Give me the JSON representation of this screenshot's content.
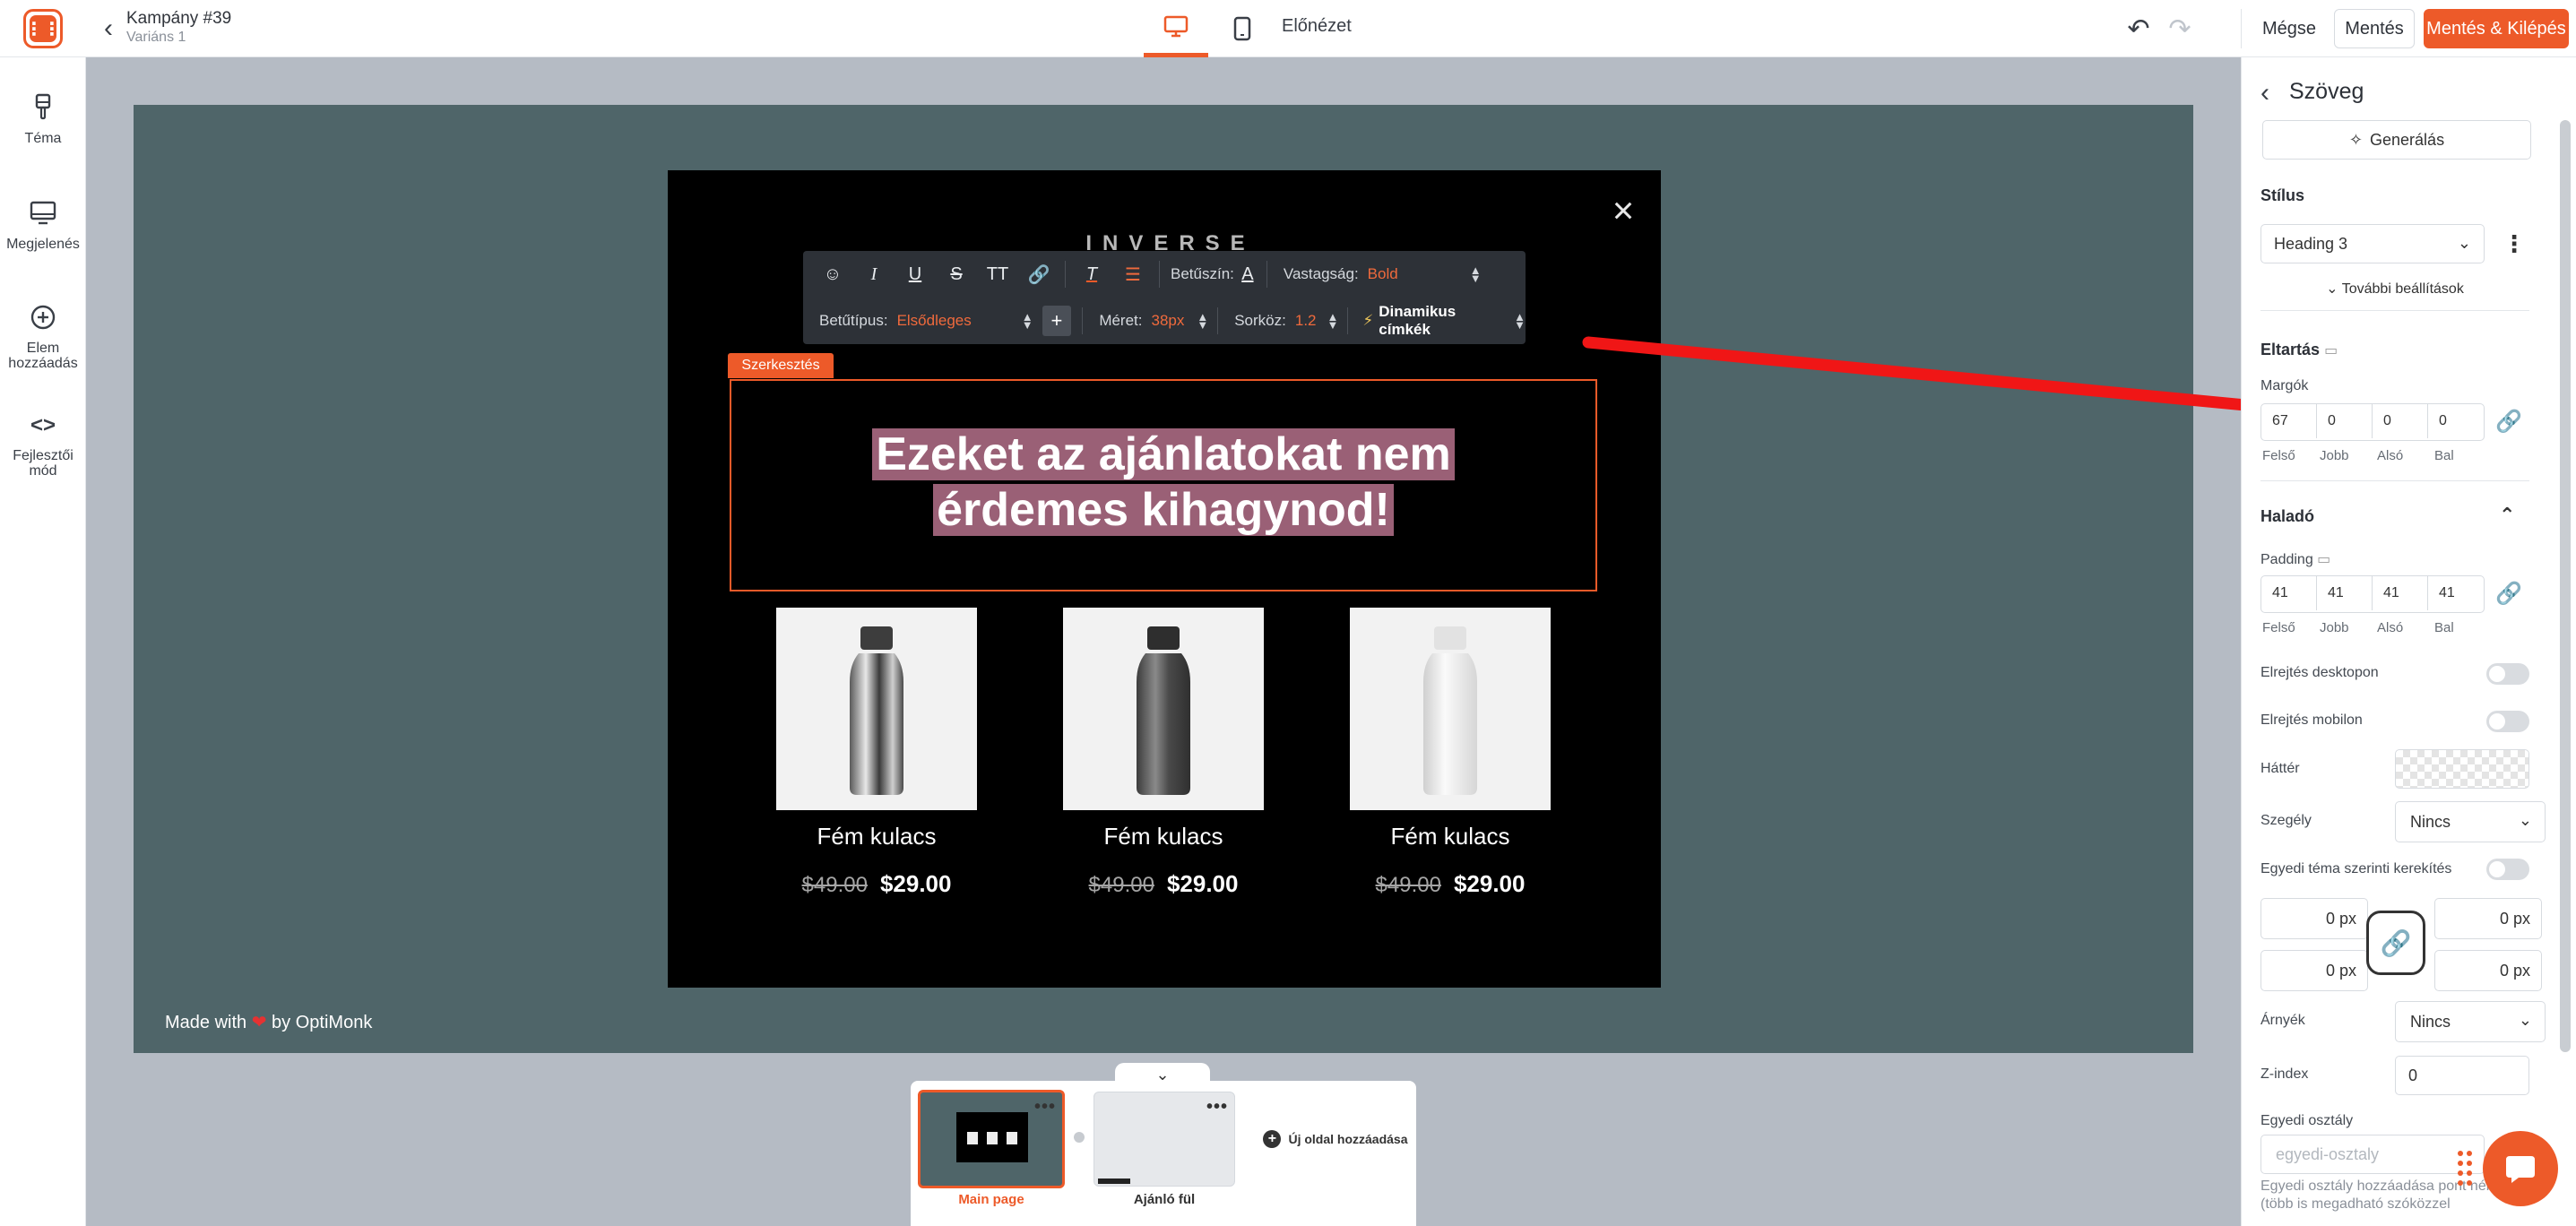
{
  "app": {
    "campaign_title": "Kampány #39",
    "variant": "Variáns 1",
    "preview": "Előnézet",
    "cancel": "Mégse",
    "save": "Mentés",
    "save_exit": "Mentés & Kilépés",
    "accent_color": "#ed5a29"
  },
  "sidebar": {
    "items": [
      {
        "label": "Téma",
        "icon": "paintbrush-icon"
      },
      {
        "label": "Megjelenés",
        "icon": "monitor-icon"
      },
      {
        "label": "Elem hozzáadás",
        "icon": "plus-circle-icon"
      },
      {
        "label": "Fejlesztői mód",
        "icon": "code-icon"
      }
    ]
  },
  "canvas": {
    "made_with_prefix": "Made with",
    "made_with_suffix": "by OptiMonk",
    "brand_logo": "INVERSE",
    "edit_tag": "Szerkesztés",
    "headline_line1": "Ezeket az ajánlatokat nem",
    "headline_line2": "érdemes kihagynod!",
    "products": [
      {
        "name": "Fém kulacs",
        "old_price": "$49.00",
        "new_price": "$29.00",
        "color": "silver"
      },
      {
        "name": "Fém kulacs",
        "old_price": "$49.00",
        "new_price": "$29.00",
        "color": "dark-grey"
      },
      {
        "name": "Fém kulacs",
        "old_price": "$49.00",
        "new_price": "$29.00",
        "color": "white"
      }
    ]
  },
  "toolbar": {
    "font_color_label": "Betűszín:",
    "weight_label": "Vastagság:",
    "weight_value": "Bold",
    "font_type_label": "Betűtípus:",
    "font_type_value": "Elsődleges",
    "size_label": "Méret:",
    "size_value": "38px",
    "line_height_label": "Sorköz:",
    "line_height_value": "1.2",
    "dynamic_tags": "Dinamikus címkék",
    "tt_glyph": "TT"
  },
  "pages": {
    "main_label": "Main page",
    "offer_label": "Ajánló fül",
    "add_label": "Új oldal hozzáadása"
  },
  "panel": {
    "title": "Szöveg",
    "generate": "Generálás",
    "style_heading": "Stílus",
    "style_value": "Heading 3",
    "more_settings": "További beállítások",
    "spacing_heading": "Eltartás",
    "margins_label": "Margók",
    "margins": [
      "67",
      "0",
      "0",
      "0"
    ],
    "side_labels": [
      "Felső",
      "Jobb",
      "Alsó",
      "Bal"
    ],
    "advanced_heading": "Haladó",
    "padding_label": "Padding",
    "padding": [
      "41",
      "41",
      "41",
      "41"
    ],
    "hide_desktop": "Elrejtés desktopon",
    "hide_mobile": "Elrejtés mobilon",
    "background_label": "Háttér",
    "border_label": "Szegély",
    "border_value": "Nincs",
    "theme_radius_label": "Egyedi téma szerinti kerekítés",
    "radius_values": [
      "0 px",
      "0 px",
      "0 px",
      "0 px"
    ],
    "shadow_label": "Árnyék",
    "shadow_value": "Nincs",
    "zindex_label": "Z-index",
    "zindex_value": "0",
    "custom_class_label": "Egyedi osztály",
    "custom_class_placeholder": "egyedi-osztaly",
    "custom_class_help": "Egyedi osztály hozzáadása pont nélkül (több is megadható szóközzel"
  }
}
